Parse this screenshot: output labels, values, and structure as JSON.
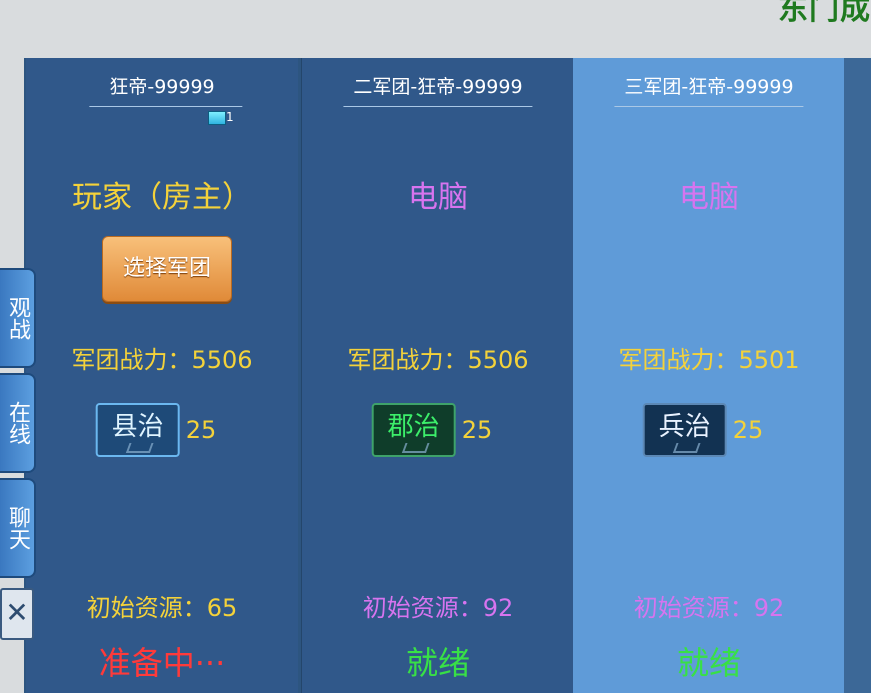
{
  "header": {
    "corner_title": "东门成"
  },
  "side_tabs": [
    {
      "label": "观战"
    },
    {
      "label": "在线"
    },
    {
      "label": "聊天"
    }
  ],
  "close": {
    "label": "✕"
  },
  "slots": [
    {
      "name": "狂帝-99999",
      "host_badge": "1",
      "role": "玩家（房主）",
      "select_button": "选择军团",
      "power": "军团战力：5506",
      "rank_title": "县治",
      "rank_level": "25",
      "resource": "初始资源：65",
      "status": "准备中···"
    },
    {
      "name": "二军团-狂帝-99999",
      "role": "电脑",
      "power": "军团战力：5506",
      "rank_title": "郡治",
      "rank_level": "25",
      "resource": "初始资源：92",
      "status": "就绪"
    },
    {
      "name": "三军团-狂帝-99999",
      "role": "电脑",
      "power": "军团战力：5501",
      "rank_title": "兵治",
      "rank_level": "25",
      "resource": "初始资源：92",
      "status": "就绪"
    }
  ],
  "colors": {
    "player": "#f4d23a",
    "ai": "#d774ef",
    "ready": "#38e046",
    "waiting": "#ff3a3a"
  }
}
